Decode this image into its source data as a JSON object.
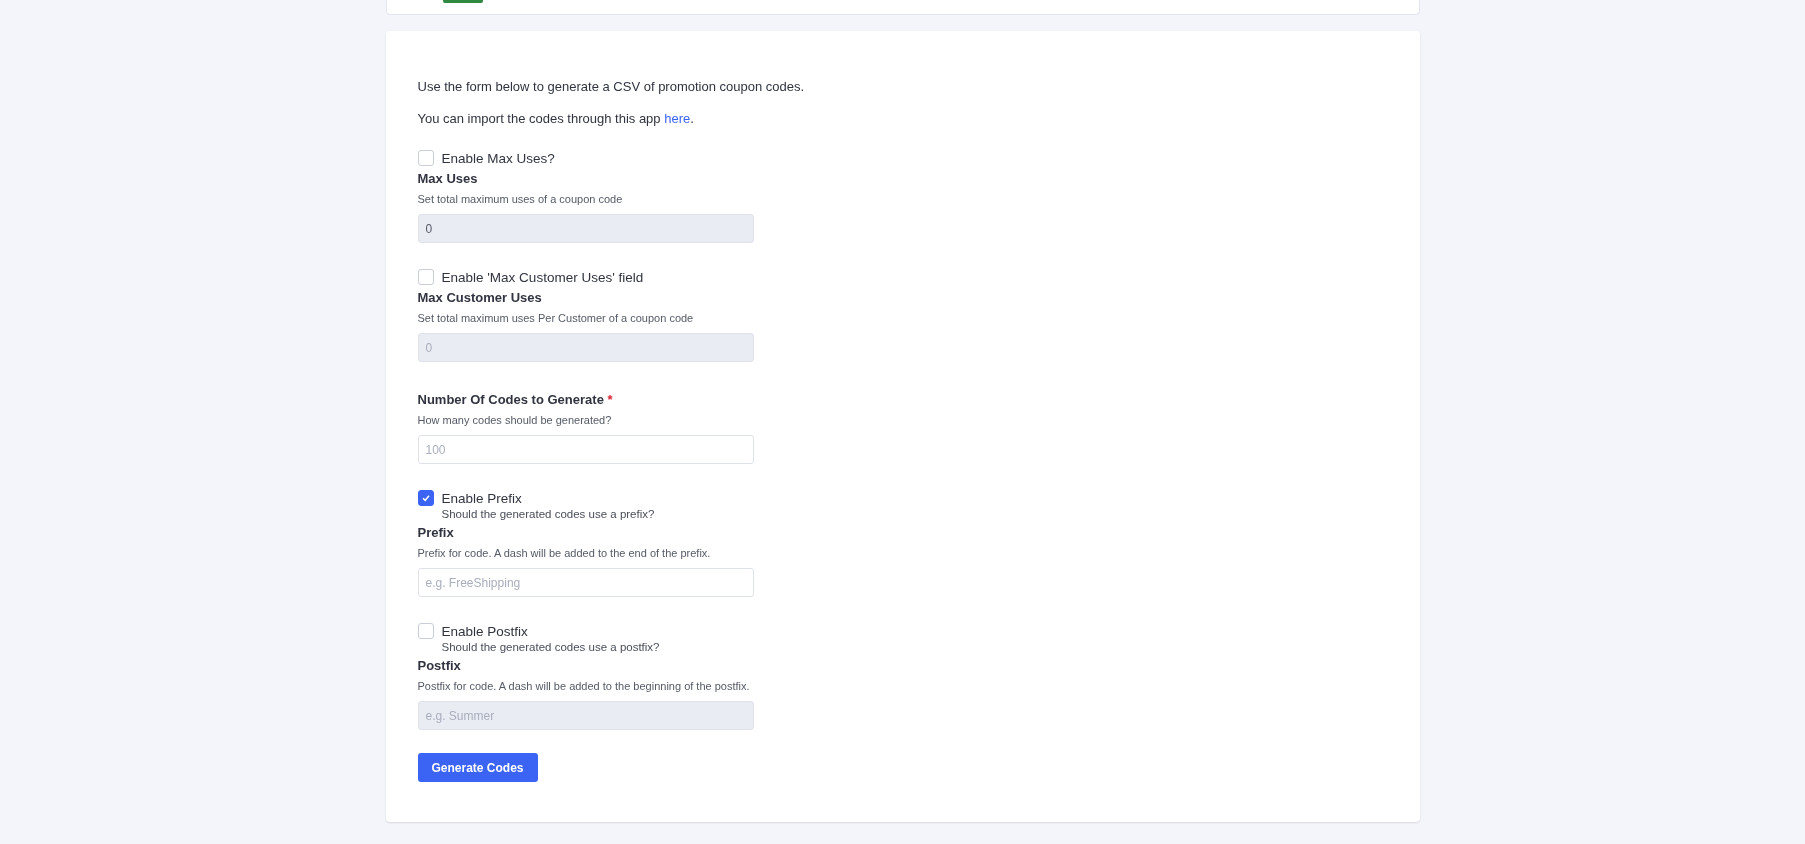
{
  "intro": [
    "Use the form below to generate a CSV of promotion coupon codes.",
    "You can import the codes through this app "
  ],
  "intro_link": "here",
  "intro_end": ".",
  "items": [
    {
      "kind": "checkbox",
      "label": "Enable Max Uses?",
      "checked": false
    },
    {
      "kind": "field",
      "label": "Max Uses",
      "required": false,
      "description": "Set total maximum uses of a coupon code",
      "value": "0",
      "disabled": true
    },
    {
      "kind": "checkbox",
      "label": "Enable 'Max Customer Uses' field",
      "checked": false
    },
    {
      "kind": "field",
      "label": "Max Customer Uses",
      "required": false,
      "description": "Set total maximum uses Per Customer of a coupon code",
      "placeholder": "0",
      "disabled": true
    },
    {
      "kind": "field",
      "label": "Number Of Codes to Generate",
      "required": true,
      "description": "How many codes should be generated?",
      "placeholder": "100",
      "disabled": false
    },
    {
      "kind": "checkbox",
      "label": "Enable Prefix",
      "hint": "Should the generated codes use a prefix?",
      "checked": true
    },
    {
      "kind": "field",
      "label": "Prefix",
      "required": false,
      "description": "Prefix for code. A dash will be added to the end of the prefix.",
      "placeholder": "e.g. FreeShipping",
      "disabled": false
    },
    {
      "kind": "checkbox",
      "label": "Enable Postfix",
      "hint": "Should the generated codes use a postfix?",
      "checked": false
    },
    {
      "kind": "field",
      "label": "Postfix",
      "required": false,
      "description": "Postfix for code. A dash will be added to the beginning of the postfix.",
      "placeholder": "e.g. Summer",
      "disabled": true
    }
  ],
  "required_mark": "*",
  "submit": "Generate Codes"
}
